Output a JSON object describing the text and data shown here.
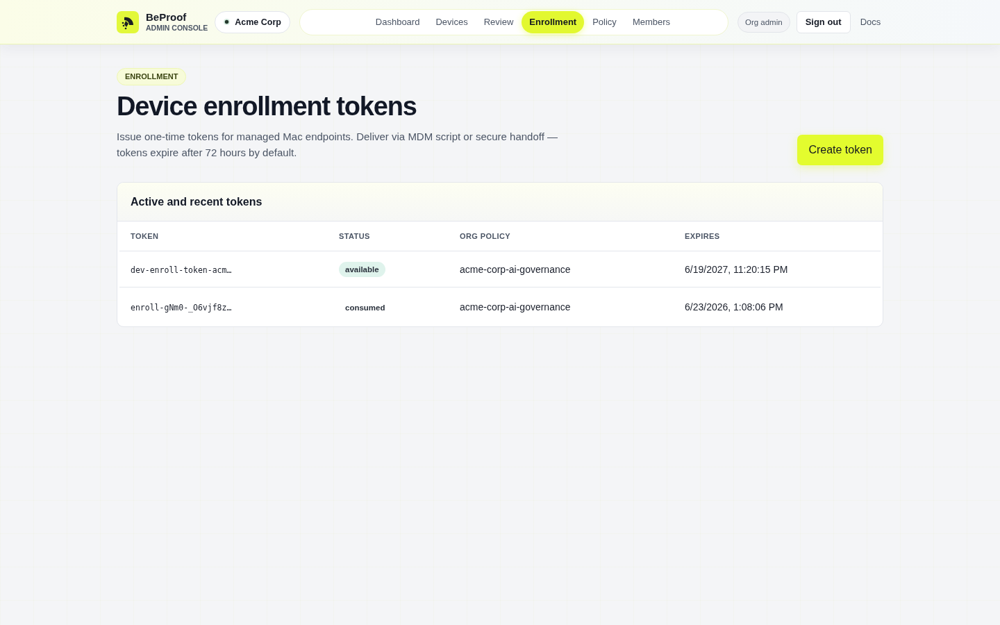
{
  "header": {
    "brand": {
      "name": "BeProof",
      "subtitle": "ADMIN CONSOLE"
    },
    "org": {
      "name": "Acme Corp"
    },
    "nav": [
      {
        "label": "Dashboard",
        "selected": false
      },
      {
        "label": "Devices",
        "selected": false
      },
      {
        "label": "Review",
        "selected": false
      },
      {
        "label": "Enrollment",
        "selected": true
      },
      {
        "label": "Policy",
        "selected": false
      },
      {
        "label": "Members",
        "selected": false
      }
    ],
    "role": "Org admin",
    "sign_out": "Sign out",
    "docs": "Docs"
  },
  "page": {
    "eyebrow": "ENROLLMENT",
    "title": "Device enrollment tokens",
    "description": "Issue one-time tokens for managed Mac endpoints. Deliver via MDM script or secure handoff — tokens expire after 72 hours by default.",
    "primary_action": "Create token"
  },
  "table": {
    "title": "Active and recent tokens",
    "columns": [
      "TOKEN",
      "STATUS",
      "ORG POLICY",
      "EXPIRES"
    ],
    "rows": [
      {
        "token": "dev-enroll-token-acm…",
        "status": {
          "label": "available",
          "kind": "badge"
        },
        "policy": "acme-corp-ai-governance",
        "expires": "6/19/2027, 11:20:15 PM"
      },
      {
        "token": "enroll-gNm0-_O6vjf8z…",
        "status": {
          "label": "consumed",
          "kind": "plain"
        },
        "policy": "acme-corp-ai-governance",
        "expires": "6/23/2026, 1:08:06 PM"
      }
    ]
  }
}
